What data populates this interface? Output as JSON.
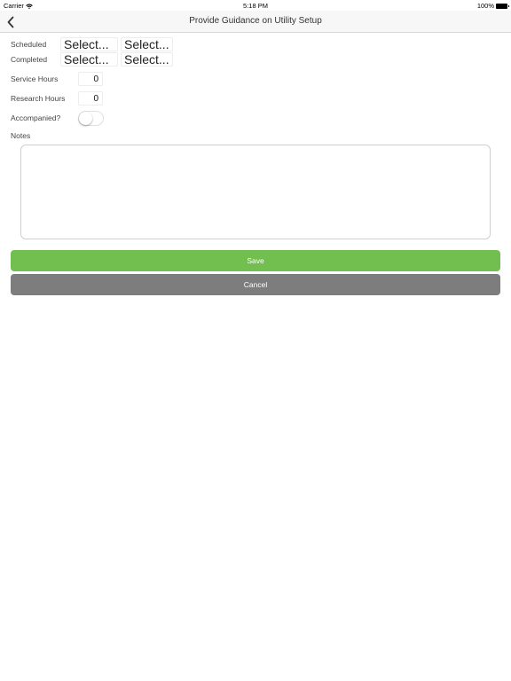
{
  "status_bar": {
    "carrier": "Carrier",
    "time": "5:18 PM",
    "battery": "100%"
  },
  "nav": {
    "title": "Provide Guidance on Utility Setup",
    "back_icon": "chevron-left-icon"
  },
  "form": {
    "scheduled_label": "Scheduled",
    "scheduled_date": "Select...",
    "scheduled_time": "Select...",
    "completed_label": "Completed",
    "completed_date": "Select...",
    "completed_time": "Select...",
    "service_hours_label": "Service Hours",
    "service_hours_value": "0",
    "research_hours_label": "Research Hours",
    "research_hours_value": "0",
    "accompanied_label": "Accompanied?",
    "accompanied_on": false,
    "notes_label": "Notes",
    "notes_value": ""
  },
  "actions": {
    "save_label": "Save",
    "cancel_label": "Cancel"
  },
  "colors": {
    "save": "#72bf50",
    "cancel": "#7d7d7d",
    "nav_bg": "#f7f7f7"
  }
}
